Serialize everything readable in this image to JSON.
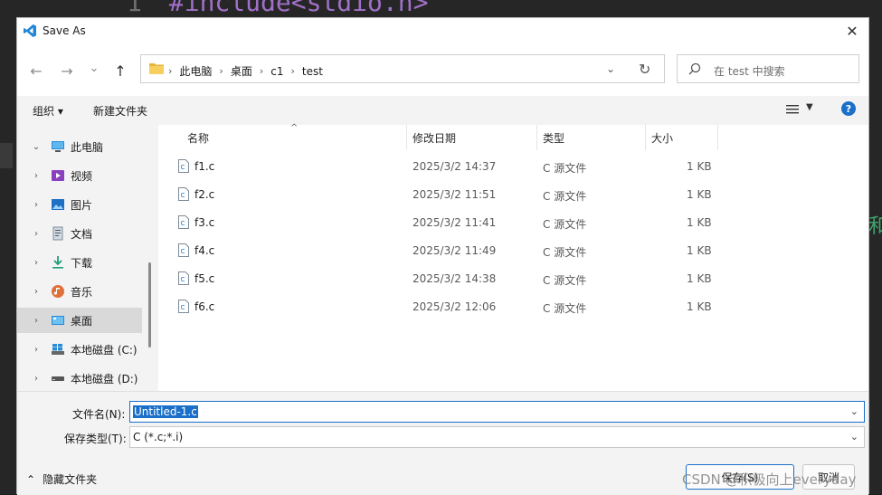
{
  "editor": {
    "line_number": "1",
    "code": "#include<stdio.h>",
    "right_char": "和"
  },
  "dialog": {
    "title": "Save As",
    "close_glyph": "✕",
    "nav": {
      "back": "←",
      "forward": "→",
      "recent": "⌄",
      "up": "↑"
    },
    "address": {
      "crumbs": [
        "此电脑",
        "桌面",
        "c1",
        "test"
      ],
      "sep": "›",
      "dropdown": "⌄",
      "refresh": "↻"
    },
    "search": {
      "placeholder": "在 test 中搜索"
    },
    "toolbar": {
      "organize": "组织 ▾",
      "new_folder": "新建文件夹",
      "view_dd": "▼",
      "help": "?"
    },
    "sidebar": {
      "items": [
        {
          "label": "此电脑",
          "chev": "⌄",
          "icon": "computer-icon"
        },
        {
          "label": "视频",
          "chev": "›",
          "icon": "video-icon"
        },
        {
          "label": "图片",
          "chev": "›",
          "icon": "picture-icon"
        },
        {
          "label": "文档",
          "chev": "›",
          "icon": "document-icon"
        },
        {
          "label": "下载",
          "chev": "›",
          "icon": "download-icon"
        },
        {
          "label": "音乐",
          "chev": "›",
          "icon": "music-icon"
        },
        {
          "label": "桌面",
          "chev": "›",
          "icon": "desktop-icon"
        },
        {
          "label": "本地磁盘 (C:)",
          "chev": "›",
          "icon": "drive-c-icon"
        },
        {
          "label": "本地磁盘 (D:)",
          "chev": "›",
          "icon": "drive-d-icon"
        }
      ]
    },
    "columns": {
      "name": "名称",
      "modified": "修改日期",
      "type": "类型",
      "size": "大小",
      "sort_glyph": "^"
    },
    "files": [
      {
        "name": "f1.c",
        "modified": "2025/3/2 14:37",
        "type": "C 源文件",
        "size": "1 KB"
      },
      {
        "name": "f2.c",
        "modified": "2025/3/2 11:51",
        "type": "C 源文件",
        "size": "1 KB"
      },
      {
        "name": "f3.c",
        "modified": "2025/3/2 11:41",
        "type": "C 源文件",
        "size": "1 KB"
      },
      {
        "name": "f4.c",
        "modified": "2025/3/2 11:49",
        "type": "C 源文件",
        "size": "1 KB"
      },
      {
        "name": "f5.c",
        "modified": "2025/3/2 14:38",
        "type": "C 源文件",
        "size": "1 KB"
      },
      {
        "name": "f6.c",
        "modified": "2025/3/2 12:06",
        "type": "C 源文件",
        "size": "1 KB"
      }
    ],
    "filename": {
      "label": "文件名(N):",
      "value": "Untitled-1.c",
      "dd": "⌄"
    },
    "filetype": {
      "label": "保存类型(T):",
      "value": "C (*.c;*.i)",
      "dd": "⌄"
    },
    "hide_folders": {
      "chev": "⌃",
      "label": "隐藏文件夹"
    },
    "buttons": {
      "save": "保存(S)",
      "cancel": "取消"
    }
  },
  "watermark": "CSDN @积极向上everyday",
  "colors": {
    "accent": "#1a6fc9",
    "selection": "#1a6fc9",
    "editor_bg": "#262626",
    "dialog_bg": "#f3f3f3"
  }
}
